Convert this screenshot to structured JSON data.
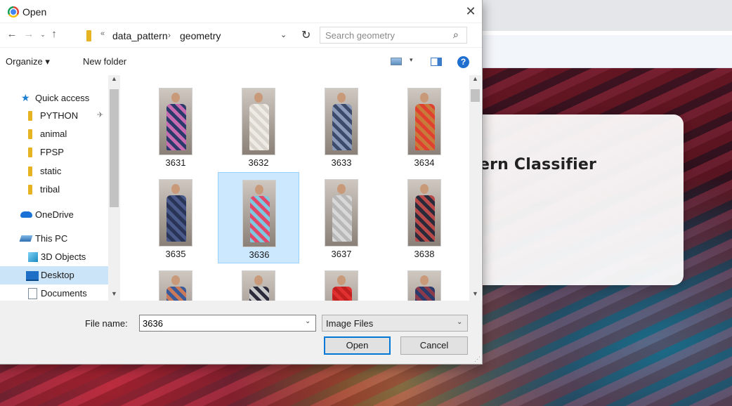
{
  "background": {
    "card_title": "ern Classifier"
  },
  "dialog": {
    "title": "Open",
    "close_glyph": "✕",
    "nav": {
      "back_glyph": "←",
      "forward_glyph": "→",
      "recent_glyph": "⌄",
      "up_glyph": "↑",
      "address_chevron": "«",
      "breadcrumbs": [
        "data_pattern",
        "geometry"
      ],
      "breadcrumb_separator": "›",
      "address_dropdown_glyph": "⌄",
      "refresh_glyph": "↻",
      "search_placeholder": "Search geometry",
      "search_glyph": "⌕"
    },
    "toolbar": {
      "organize_label": "Organize ▾",
      "new_folder_label": "New folder",
      "view_caret": "▾",
      "help_glyph": "?"
    },
    "nav_pane": {
      "quick_access": "Quick access",
      "pinned": [
        "PYTHON",
        "animal",
        "FPSP",
        "static",
        "tribal"
      ],
      "pin_glyph": "✈",
      "onedrive": "OneDrive",
      "this_pc": "This PC",
      "pc_items": [
        "3D Objects",
        "Desktop",
        "Documents"
      ],
      "selected": "Desktop",
      "scroll_up": "▲",
      "scroll_down": "▼"
    },
    "files": {
      "items": [
        {
          "name": "3631",
          "colors": [
            "#2a3a6a",
            "#c86ab0"
          ]
        },
        {
          "name": "3632",
          "colors": [
            "#eeeae4",
            "#d8d4cc"
          ]
        },
        {
          "name": "3633",
          "colors": [
            "#8a9ab8",
            "#3c4a6c"
          ]
        },
        {
          "name": "3634",
          "colors": [
            "#e04030",
            "#c87a3a"
          ]
        },
        {
          "name": "3635",
          "colors": [
            "#4a5a8a",
            "#2a3456"
          ]
        },
        {
          "name": "3636",
          "colors": [
            "#7ec8e0",
            "#e04a6a"
          ]
        },
        {
          "name": "3637",
          "colors": [
            "#d8d8d8",
            "#b8b8b8"
          ]
        },
        {
          "name": "3638",
          "colors": [
            "#b84a4a",
            "#2a2a3a"
          ]
        },
        {
          "name": "",
          "colors": [
            "#3a5a9a",
            "#c87a5a"
          ]
        },
        {
          "name": "",
          "colors": [
            "#2a2a3a",
            "#c8c8c8"
          ]
        },
        {
          "name": "",
          "colors": [
            "#e03030",
            "#c02020"
          ]
        },
        {
          "name": "",
          "colors": [
            "#2a3a6a",
            "#8a3a4a"
          ]
        }
      ],
      "selected": "3636",
      "scroll_up": "▲",
      "scroll_down": "▼"
    },
    "bottom": {
      "file_name_label": "File name:",
      "file_name_value": "3636",
      "file_name_caret": "⌄",
      "file_type": "Image Files",
      "file_type_caret": "⌄",
      "open_label": "Open",
      "cancel_label": "Cancel",
      "grip": "⋰"
    }
  }
}
